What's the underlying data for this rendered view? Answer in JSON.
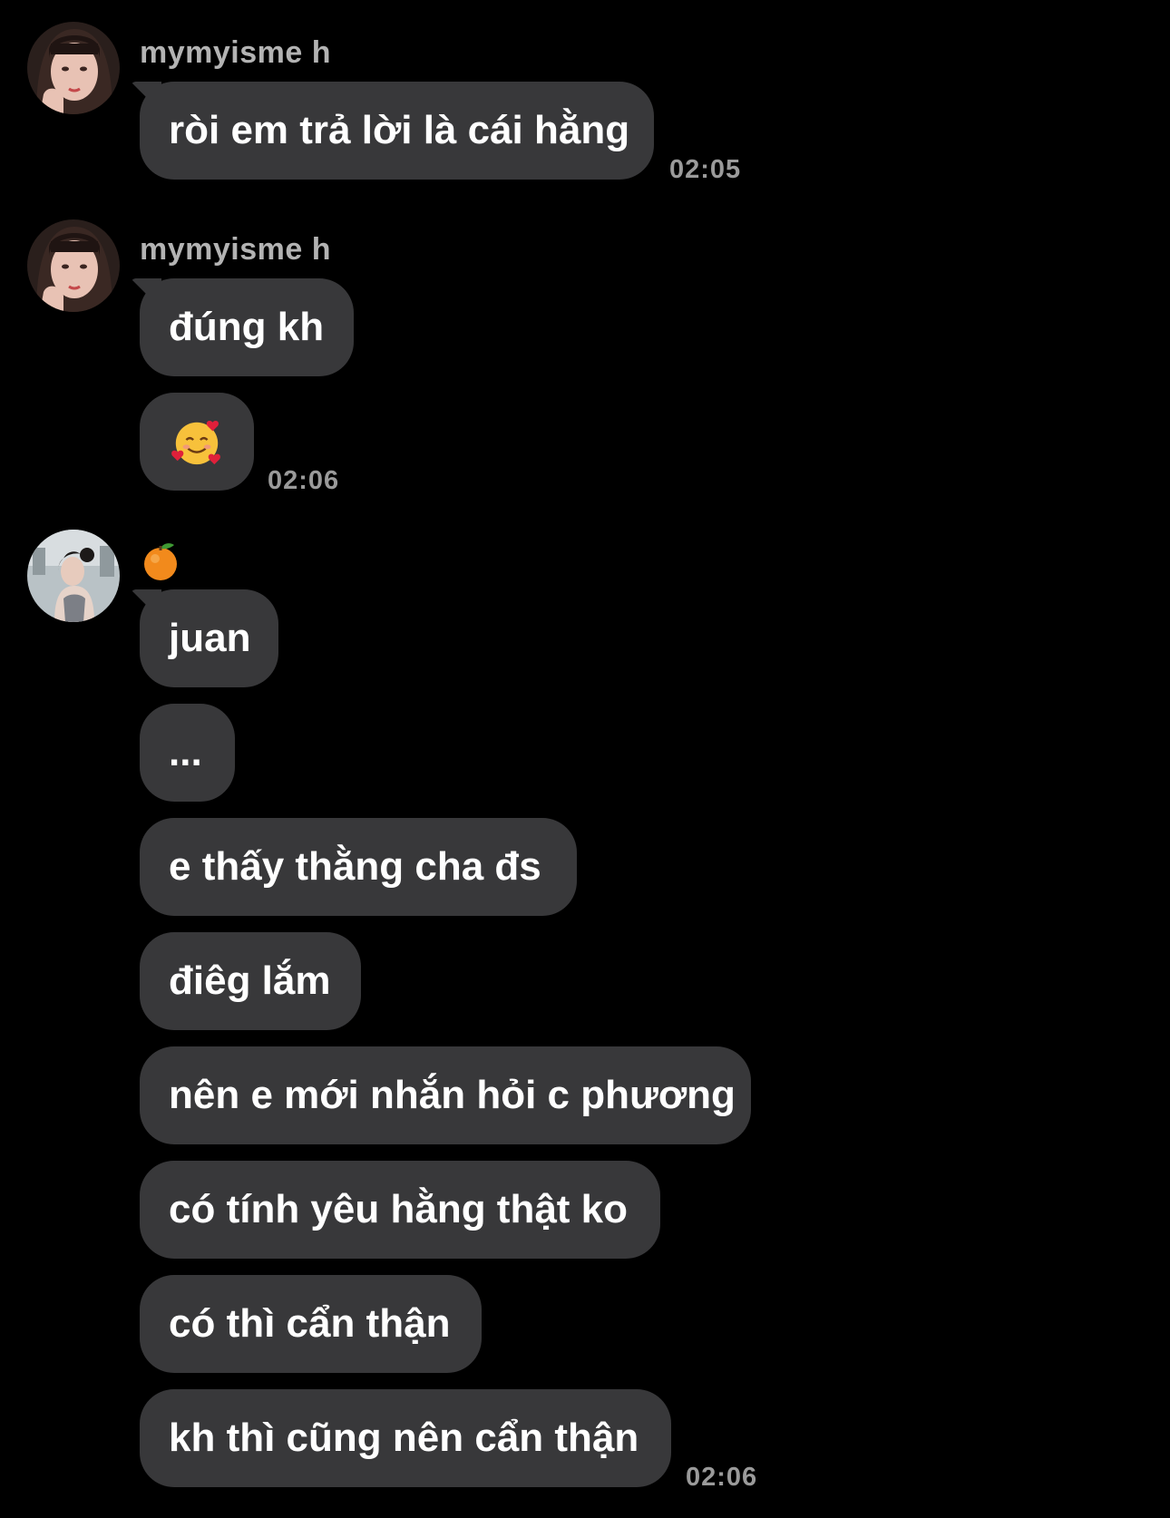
{
  "groups": [
    {
      "sender": "mymyisme h",
      "messages": [
        "ròi em trả lời là cái hằng"
      ],
      "time": "02:05"
    },
    {
      "sender": "mymyisme h",
      "messages": [
        "đúng kh"
      ],
      "time": "02:06"
    },
    {
      "sender_icon": "tangerine-icon",
      "messages": [
        "juan",
        "...",
        "e thấy thằng cha đs",
        "điêg lắm",
        "nên e mới nhắn hỏi c phương",
        "có tính yêu hằng thật ko",
        "có thì cẩn thận",
        "kh thì cũng nên cẩn thận"
      ],
      "time": "02:06"
    }
  ],
  "emoji_message_icon": "smiling-face-with-hearts-icon",
  "colors": {
    "background": "#000000",
    "bubble": "#38383a",
    "sender_name": "#b3b3b3",
    "timestamp": "#9a9a9a",
    "message_text": "#ffffff"
  }
}
